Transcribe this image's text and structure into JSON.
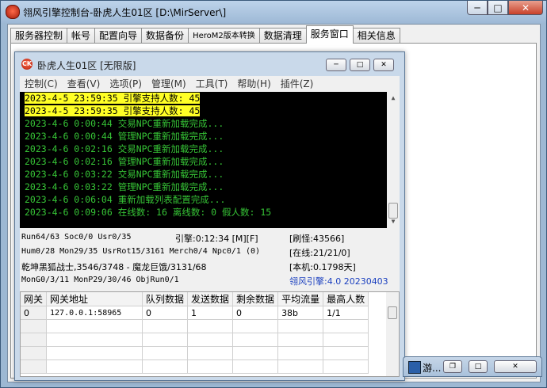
{
  "window": {
    "title": "翎风引擎控制台-卧虎人生01区 [D:\\MirServer\\]",
    "min_icon": "─",
    "max_icon": "□",
    "close_icon": "✕"
  },
  "tabs": [
    {
      "label": "服务器控制"
    },
    {
      "label": "帐号"
    },
    {
      "label": "配置向导"
    },
    {
      "label": "数据备份"
    },
    {
      "label": "HeroM2版本转换"
    },
    {
      "label": "数据清理"
    },
    {
      "label": "服务窗口"
    },
    {
      "label": "相关信息"
    }
  ],
  "active_tab": "服务窗口",
  "service_window": {
    "title": "卧虎人生01区 [无限版]",
    "icon_text": "CK",
    "menu": [
      "控制(C)",
      "查看(V)",
      "选项(P)",
      "管理(M)",
      "工具(T)",
      "帮助(H)",
      "插件(Z)"
    ],
    "log": [
      {
        "text": "2023-4-5 23:59:35 引擎支持人数: 45",
        "highlight": true
      },
      {
        "text": "2023-4-5 23:59:35 引擎支持人数: 45",
        "highlight": true
      },
      {
        "text": "2023-4-6 0:00:44 交易NPC重新加载完成...",
        "highlight": false
      },
      {
        "text": "2023-4-6 0:00:44 管理NPC重新加载完成...",
        "highlight": false
      },
      {
        "text": "2023-4-6 0:02:16 交易NPC重新加载完成...",
        "highlight": false
      },
      {
        "text": "2023-4-6 0:02:16 管理NPC重新加载完成...",
        "highlight": false
      },
      {
        "text": "2023-4-6 0:03:22 交易NPC重新加载完成...",
        "highlight": false
      },
      {
        "text": "2023-4-6 0:03:22 管理NPC重新加载完成...",
        "highlight": false
      },
      {
        "text": "2023-4-6 0:06:04 重新加载列表配置完成...",
        "highlight": false
      },
      {
        "text": "2023-4-6 0:09:06 在线数: 16 离线数: 0 假人数: 15",
        "highlight": false
      }
    ],
    "stats": {
      "run": "Run64/63 Soc0/0 Usr0/35",
      "engine_time": "引擎:0:12:34 [M][F]",
      "refresh": "[刷怪:43566]",
      "hum": "Hum0/28 Mon29/35 UsrRot15/3161 Merch0/4 Npc0/1 (0)",
      "online": "[在线:21/21/0]",
      "player": "乾坤黑狐战士,3546/3748 - 魔龙巨饿/3131/68",
      "local": "[本机:0.1798天]",
      "mongen": "MonG0/3/11 MonP29/30/46 ObjRun0/1",
      "version": "翎风引擎:4.0 20230403"
    },
    "version_color": "#1a3fbf",
    "gateway_table": {
      "columns": [
        "网关",
        "网关地址",
        "队列数据",
        "发送数据",
        "剩余数据",
        "平均流量",
        "最高人数"
      ],
      "rows": [
        [
          "0",
          "127.0.0.1:58965",
          "0",
          "1",
          "0",
          "38b",
          "1/1"
        ]
      ]
    }
  },
  "minimized_window": {
    "label": "游..."
  }
}
